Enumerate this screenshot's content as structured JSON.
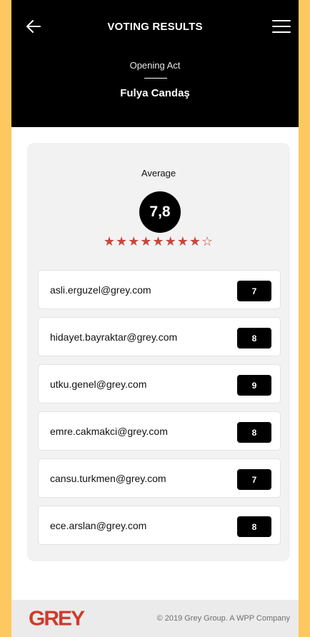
{
  "header": {
    "title": "VOTING RESULTS",
    "subtitle": "Opening Act",
    "performer": "Fulya Candaş",
    "back_icon": "arrow-left-icon",
    "menu_icon": "hamburger-menu-icon"
  },
  "summary": {
    "average_label": "Average",
    "average_value": "7,8",
    "rating_filled": 8,
    "rating_max": 9
  },
  "votes": [
    {
      "email": "asli.erguzel@grey.com",
      "score": "7"
    },
    {
      "email": "hidayet.bayraktar@grey.com",
      "score": "8"
    },
    {
      "email": "utku.genel@grey.com",
      "score": "9"
    },
    {
      "email": "emre.cakmakci@grey.com",
      "score": "8"
    },
    {
      "email": "cansu.turkmen@grey.com",
      "score": "7"
    },
    {
      "email": "ece.arslan@grey.com",
      "score": "8"
    }
  ],
  "footer": {
    "logo": "GREY",
    "copyright": "© 2019 Grey Group. A WPP Company"
  },
  "colors": {
    "background": "#FDC85F",
    "header": "#000000",
    "accent": "#C8463A",
    "logo": "#D03A2B"
  }
}
